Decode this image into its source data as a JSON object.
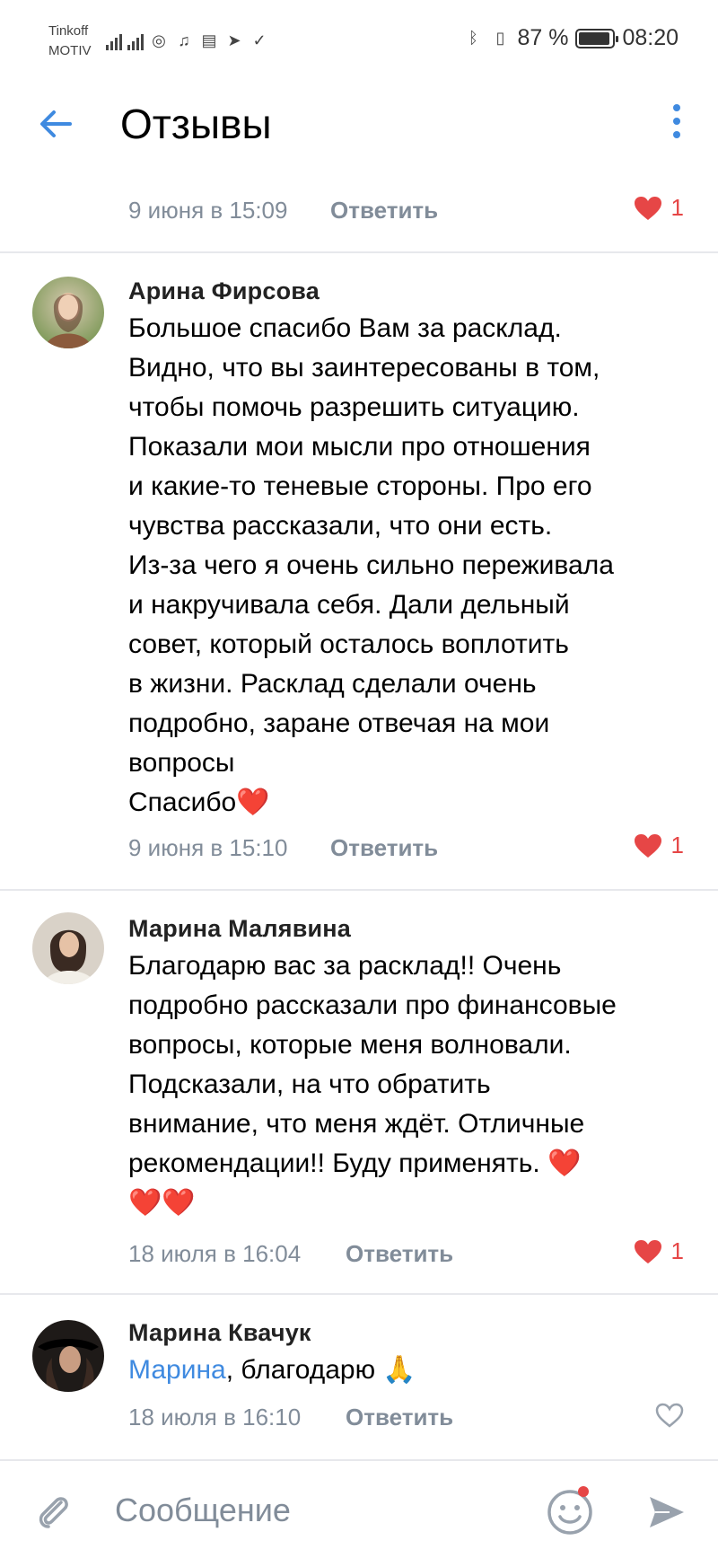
{
  "status_bar": {
    "carrier_line1": "Tinkoff",
    "carrier_line2": "MOTIV",
    "battery": "87 %",
    "time": "08:20"
  },
  "header": {
    "title": "Отзывы"
  },
  "comments": [
    {
      "date": "9 июня в 15:09",
      "reply": "Ответить",
      "likes": "1"
    },
    {
      "author": "Арина Фирсова",
      "text": "Большое спасибо Вам за расклад.\nВидно, что вы заинтересованы в том,\nчтобы помочь разрешить ситуацию.\nПоказали мои мысли про отношения\nи какие-то теневые стороны. Про его\nчувства рассказали, что они есть.\nИз-за чего я очень сильно переживала\nи накручивала себя. Дали дельный\nсовет, который осталось воплотить\nв жизни. Расклад сделали очень\nподробно, заране отвечая на мои\nвопросы\nСпасибо❤️",
      "date": "9 июня в 15:10",
      "reply": "Ответить",
      "likes": "1"
    },
    {
      "author": "Марина Малявина",
      "text": "Благодарю вас за расклад!! Очень\nподробно рассказали про финансовые\nвопросы, которые меня волновали.\nПодсказали, на что обратить\nвнимание, что меня ждёт. Отличные\nрекомендации!! Буду применять. ❤️\n❤️❤️",
      "date": "18 июля в 16:04",
      "reply": "Ответить",
      "likes": "1"
    },
    {
      "author": "Марина Квачук",
      "mention": "Марина",
      "text": ", благодарю 🙏",
      "date": "18 июля в 16:10",
      "reply": "Ответить"
    }
  ],
  "composer": {
    "placeholder": "Сообщение"
  },
  "colors": {
    "accent": "#3f8ae0",
    "like": "#e64646",
    "meta": "#818c99"
  }
}
